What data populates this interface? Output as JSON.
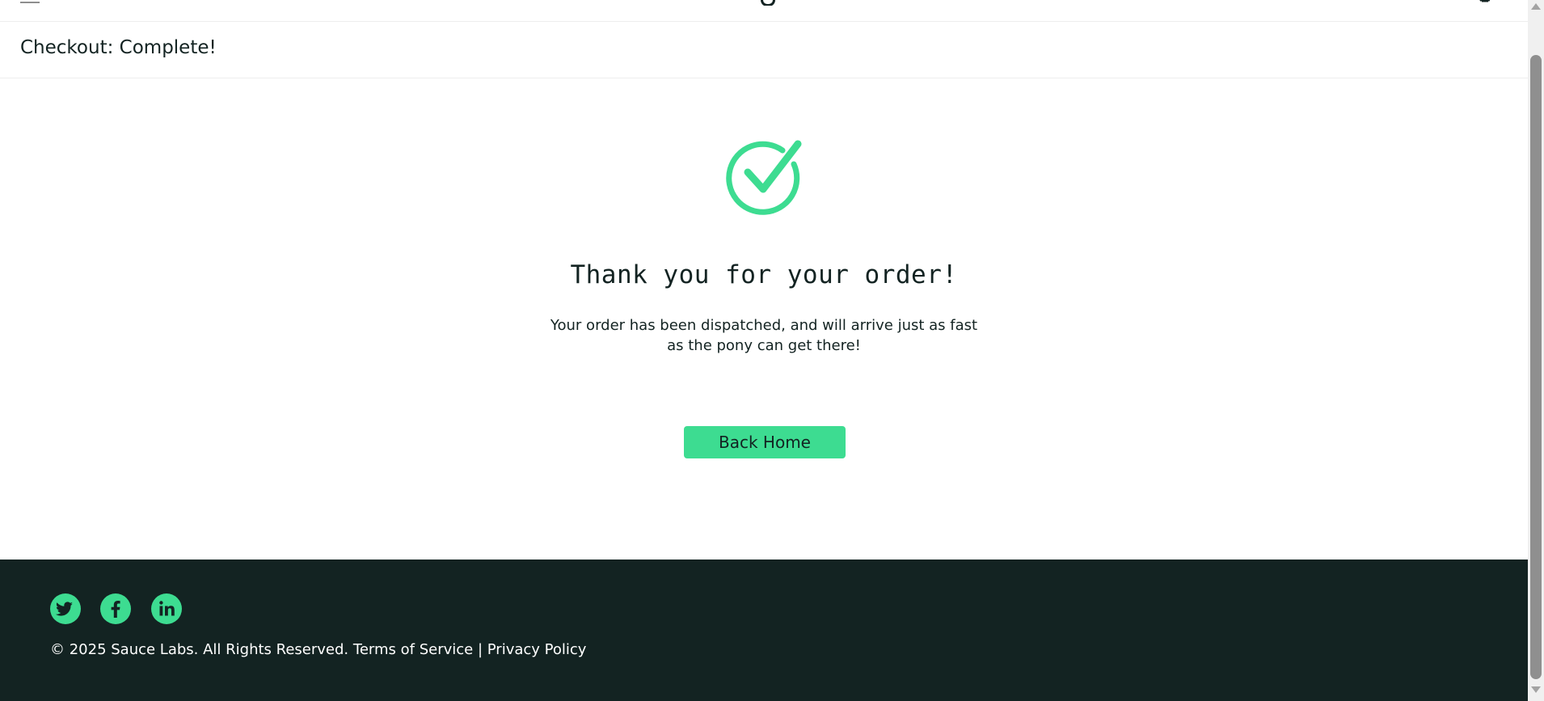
{
  "header": {
    "page_title": "Checkout: Complete!"
  },
  "complete": {
    "heading": "Thank you for your order!",
    "text": "Your order has been dispatched, and will arrive just as fast as the pony can get there!",
    "back_home_label": "Back Home"
  },
  "footer": {
    "social": [
      {
        "icon": "twitter-icon"
      },
      {
        "icon": "facebook-icon"
      },
      {
        "icon": "linkedin-icon"
      }
    ],
    "copyright": "© 2025 Sauce Labs. All Rights Reserved.",
    "terms_label": "Terms of Service",
    "separator": "|",
    "privacy_label": "Privacy Policy"
  },
  "colors": {
    "accent": "#3ddc91",
    "footer_bg": "#132322",
    "text": "#132322"
  }
}
